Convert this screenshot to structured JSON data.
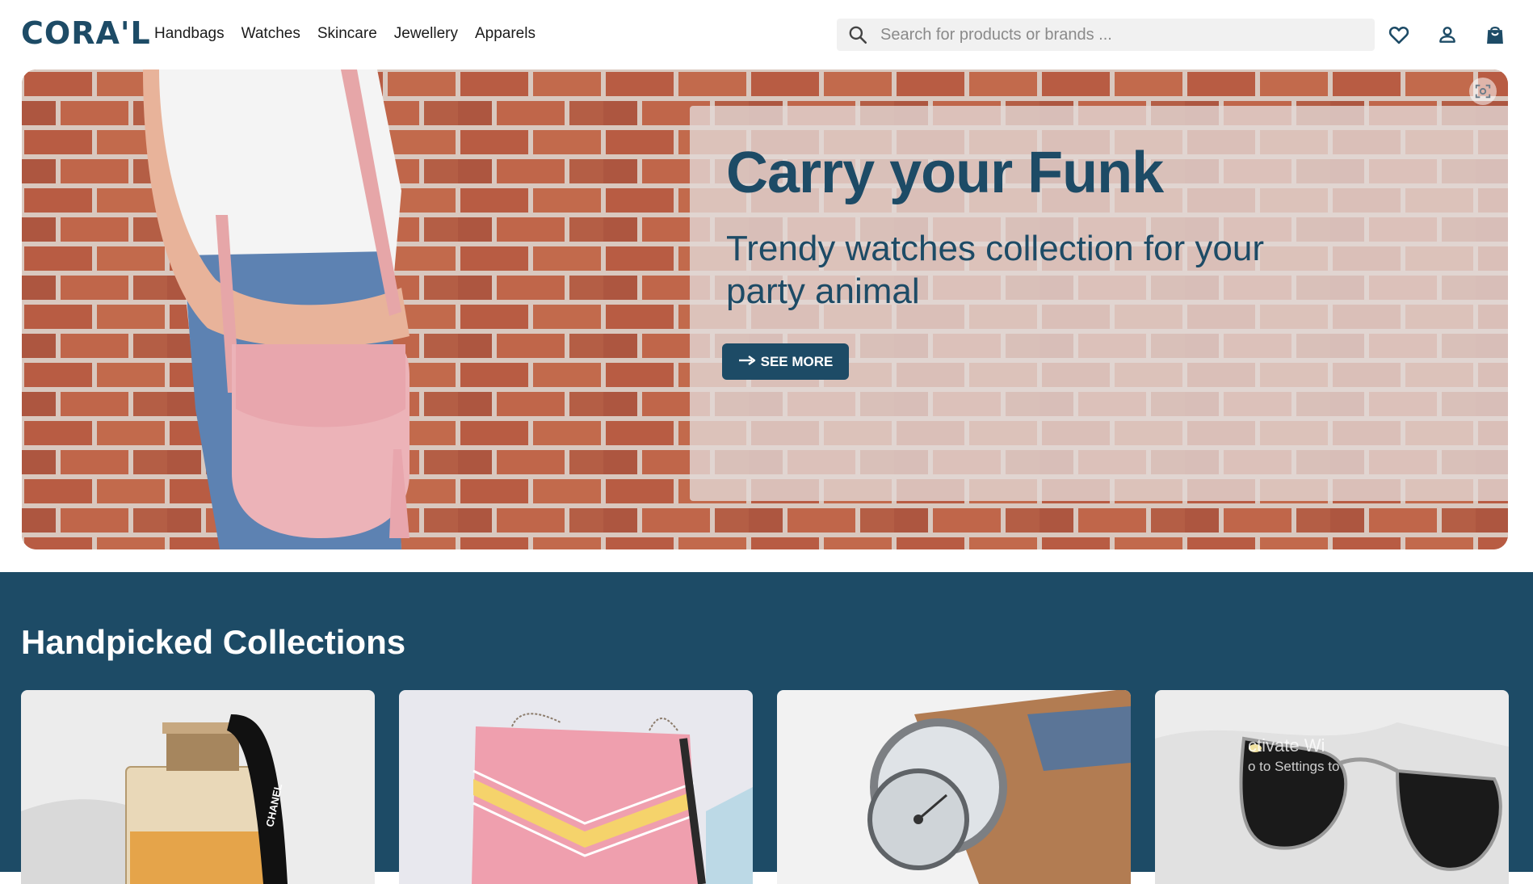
{
  "header": {
    "logo": "CORA'L",
    "nav": [
      "Handbags",
      "Watches",
      "Skincare",
      "Jewellery",
      "Apparels"
    ],
    "search_placeholder": "Search for products or brands ...",
    "icons": [
      "search-icon",
      "heart-icon",
      "user-icon",
      "bag-icon"
    ]
  },
  "hero": {
    "title": "Carry your Funk",
    "subtitle": "Trendy watches collection for your party animal",
    "button_label": "SEE MORE",
    "button_icon": "arrow-right-icon",
    "corner_icon": "screenshot-icon"
  },
  "collections": {
    "title": "Handpicked Collections",
    "cards": [
      {
        "name": "perfume",
        "image_text": "CHANEL"
      },
      {
        "name": "pink-bag"
      },
      {
        "name": "watch"
      },
      {
        "name": "sunglasses"
      }
    ]
  },
  "watermark": {
    "line1": "ctivate Wi",
    "line2": "o to Settings to"
  },
  "colors": {
    "brand": "#1d4b66",
    "panel": "#e2d8d6",
    "search_bg": "#f1f1f1"
  }
}
